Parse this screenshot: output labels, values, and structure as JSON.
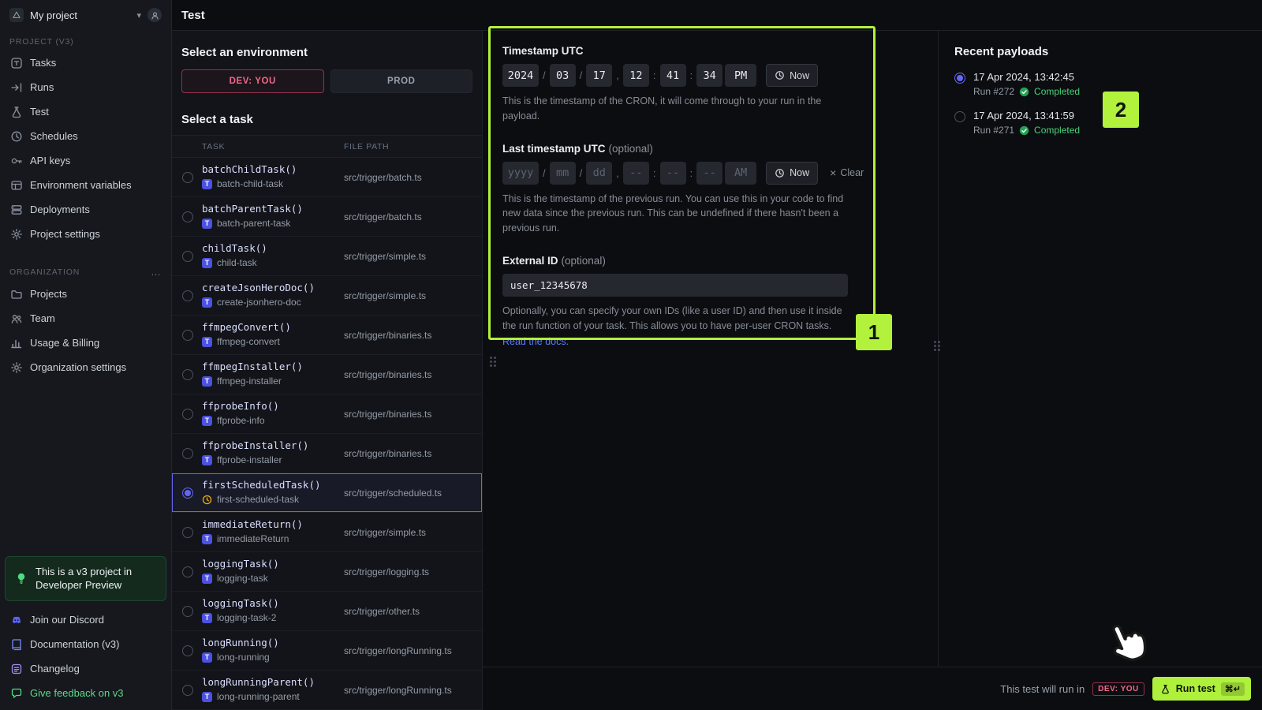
{
  "glyphs": {
    "slash": "/",
    "comma": ",",
    "colon": ":",
    "clear_x": "×",
    "dots": "…",
    "chevron": "▾",
    "task_badge": "T",
    "shortcut": "⌘↵"
  },
  "sidebar": {
    "project_switcher": "My project",
    "section_project": {
      "label": "PROJECT (V3)",
      "items": [
        {
          "label": "Tasks"
        },
        {
          "label": "Runs"
        },
        {
          "label": "Test"
        },
        {
          "label": "Schedules"
        },
        {
          "label": "API keys"
        },
        {
          "label": "Environment variables"
        },
        {
          "label": "Deployments"
        },
        {
          "label": "Project settings"
        }
      ]
    },
    "section_org": {
      "label": "ORGANIZATION",
      "items": [
        {
          "label": "Projects"
        },
        {
          "label": "Team"
        },
        {
          "label": "Usage & Billing"
        },
        {
          "label": "Organization settings"
        }
      ]
    },
    "notice": "This is a v3 project in Developer Preview",
    "footer": [
      {
        "label": "Join our Discord"
      },
      {
        "label": "Documentation (v3)"
      },
      {
        "label": "Changelog"
      },
      {
        "label": "Give feedback on v3"
      }
    ]
  },
  "header": {
    "title": "Test"
  },
  "environment": {
    "heading": "Select an environment",
    "options": [
      {
        "label": "DEV: YOU",
        "selected": true
      },
      {
        "label": "PROD",
        "selected": false
      }
    ]
  },
  "task_picker": {
    "heading": "Select a task",
    "columns": {
      "task": "TASK",
      "file": "FILE PATH"
    },
    "tasks": [
      {
        "name": "batchChildTask()",
        "slug": "batch-child-task",
        "file": "src/trigger/batch.ts",
        "selected": false,
        "clock": false
      },
      {
        "name": "batchParentTask()",
        "slug": "batch-parent-task",
        "file": "src/trigger/batch.ts",
        "selected": false,
        "clock": false
      },
      {
        "name": "childTask()",
        "slug": "child-task",
        "file": "src/trigger/simple.ts",
        "selected": false,
        "clock": false
      },
      {
        "name": "createJsonHeroDoc()",
        "slug": "create-jsonhero-doc",
        "file": "src/trigger/simple.ts",
        "selected": false,
        "clock": false
      },
      {
        "name": "ffmpegConvert()",
        "slug": "ffmpeg-convert",
        "file": "src/trigger/binaries.ts",
        "selected": false,
        "clock": false
      },
      {
        "name": "ffmpegInstaller()",
        "slug": "ffmpeg-installer",
        "file": "src/trigger/binaries.ts",
        "selected": false,
        "clock": false
      },
      {
        "name": "ffprobeInfo()",
        "slug": "ffprobe-info",
        "file": "src/trigger/binaries.ts",
        "selected": false,
        "clock": false
      },
      {
        "name": "ffprobeInstaller()",
        "slug": "ffprobe-installer",
        "file": "src/trigger/binaries.ts",
        "selected": false,
        "clock": false
      },
      {
        "name": "firstScheduledTask()",
        "slug": "first-scheduled-task",
        "file": "src/trigger/scheduled.ts",
        "selected": true,
        "clock": true
      },
      {
        "name": "immediateReturn()",
        "slug": "immediateReturn",
        "file": "src/trigger/simple.ts",
        "selected": false,
        "clock": false
      },
      {
        "name": "loggingTask()",
        "slug": "logging-task",
        "file": "src/trigger/logging.ts",
        "selected": false,
        "clock": false
      },
      {
        "name": "loggingTask()",
        "slug": "logging-task-2",
        "file": "src/trigger/other.ts",
        "selected": false,
        "clock": false
      },
      {
        "name": "longRunning()",
        "slug": "long-running",
        "file": "src/trigger/longRunning.ts",
        "selected": false,
        "clock": false
      },
      {
        "name": "longRunningParent()",
        "slug": "long-running-parent",
        "file": "src/trigger/longRunning.ts",
        "selected": false,
        "clock": false
      }
    ]
  },
  "form": {
    "timestamp": {
      "label": "Timestamp UTC",
      "segments": {
        "year": "2024",
        "month": "03",
        "day": "17",
        "hour": "12",
        "minute": "41",
        "second": "34",
        "meridiem": "PM"
      },
      "now_label": "Now",
      "help": "This is the timestamp of the CRON, it will come through to your run in the payload."
    },
    "last_timestamp": {
      "label": "Last timestamp UTC",
      "optional": "(optional)",
      "segments": {
        "year": "yyyy",
        "month": "mm",
        "day": "dd",
        "hour": "--",
        "minute": "--",
        "second": "--",
        "meridiem": "AM"
      },
      "now_label": "Now",
      "clear_label": "Clear",
      "help": "This is the timestamp of the previous run. You can use this in your code to find new data since the previous run. This can be undefined if there hasn't been a previous run."
    },
    "external_id": {
      "label": "External ID",
      "optional": "(optional)",
      "value": "user_12345678",
      "help": "Optionally, you can specify your own IDs (like a user ID) and then use it inside the run function of your task. This allows you to have per-user CRON tasks.",
      "link": "Read the docs."
    }
  },
  "payloads": {
    "heading": "Recent payloads",
    "items": [
      {
        "date": "17 Apr 2024, 13:42:45",
        "run": "Run #272",
        "status": "Completed",
        "selected": true
      },
      {
        "date": "17 Apr 2024, 13:41:59",
        "run": "Run #271",
        "status": "Completed",
        "selected": false
      }
    ]
  },
  "footer_bar": {
    "text": "This test will run in",
    "env_badge": "DEV: YOU",
    "run_label": "Run test",
    "shortcut": "⌘↵"
  },
  "annotations": {
    "box1": "1",
    "box2": "2"
  }
}
